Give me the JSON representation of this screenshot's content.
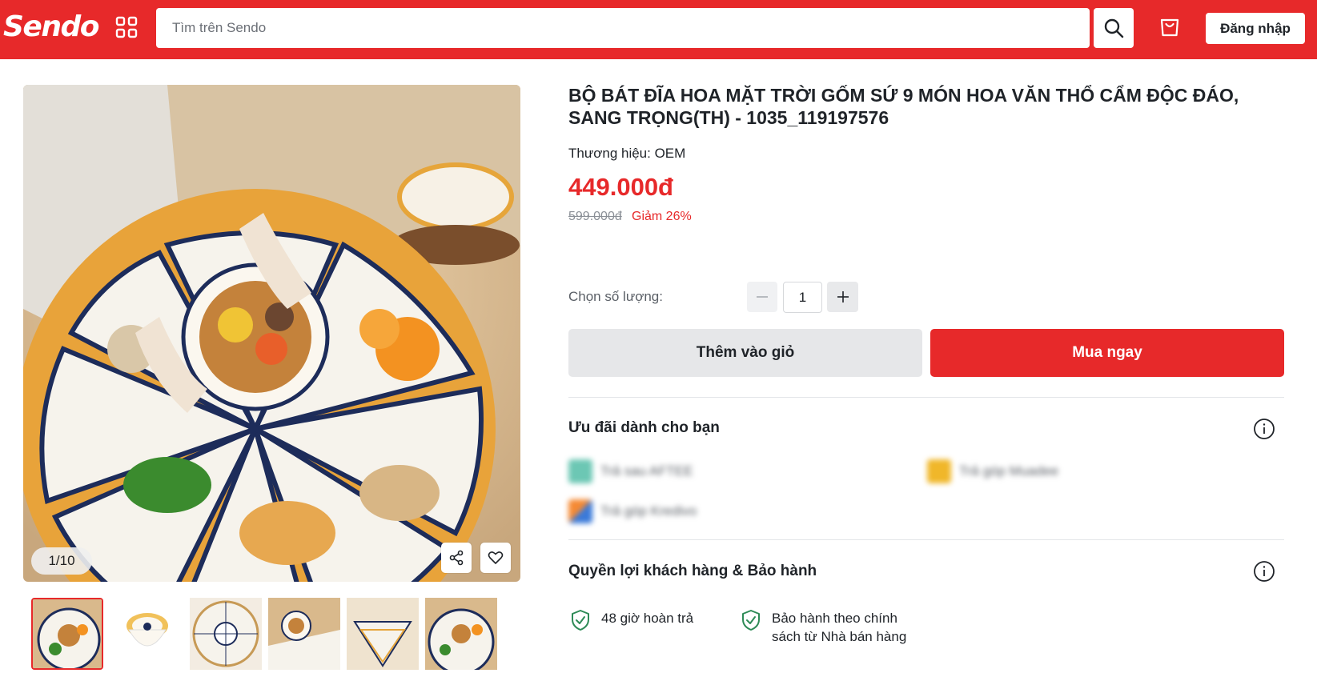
{
  "header": {
    "logo": "Sendo",
    "search_placeholder": "Tìm trên Sendo",
    "login_label": "Đăng nhập",
    "icons": [
      "grid-icon",
      "search-icon",
      "shopping-bag-icon"
    ]
  },
  "gallery": {
    "counter": "1/10",
    "thumbnail_count": 6,
    "active_thumbnail": 1,
    "icons": [
      "share-icon",
      "heart-icon"
    ]
  },
  "product": {
    "title": "BỘ BÁT ĐĨA HOA MẶT TRỜI GỐM SỨ 9 MÓN HOA VĂN THỔ CẨM ĐỘC ĐÁO, SANG TRỌNG(TH) - 1035_119197576",
    "brand": "Thương hiệu: OEM",
    "price": "449.000đ",
    "old_price": "599.000đ",
    "discount": "Giảm 26%",
    "quantity_label": "Chọn số lượng:",
    "quantity": "1",
    "add_to_cart": "Thêm vào giỏ",
    "buy_now": "Mua ngay"
  },
  "offers": {
    "title": "Ưu đãi dành cho bạn",
    "items": [
      "Trả sau AFTEE",
      "Trả góp Muadee",
      "Trả góp Kredivo"
    ]
  },
  "benefits": {
    "title": "Quyền lợi khách hàng & Bảo hành",
    "items": [
      {
        "line1": "48 giờ hoàn trả",
        "line2": ""
      },
      {
        "line1": "Bảo hành theo chính",
        "line2": "sách từ Nhà bán hàng"
      }
    ]
  },
  "colors": {
    "brand_red": "#e7292a",
    "benefit_green": "#2e8b57"
  }
}
